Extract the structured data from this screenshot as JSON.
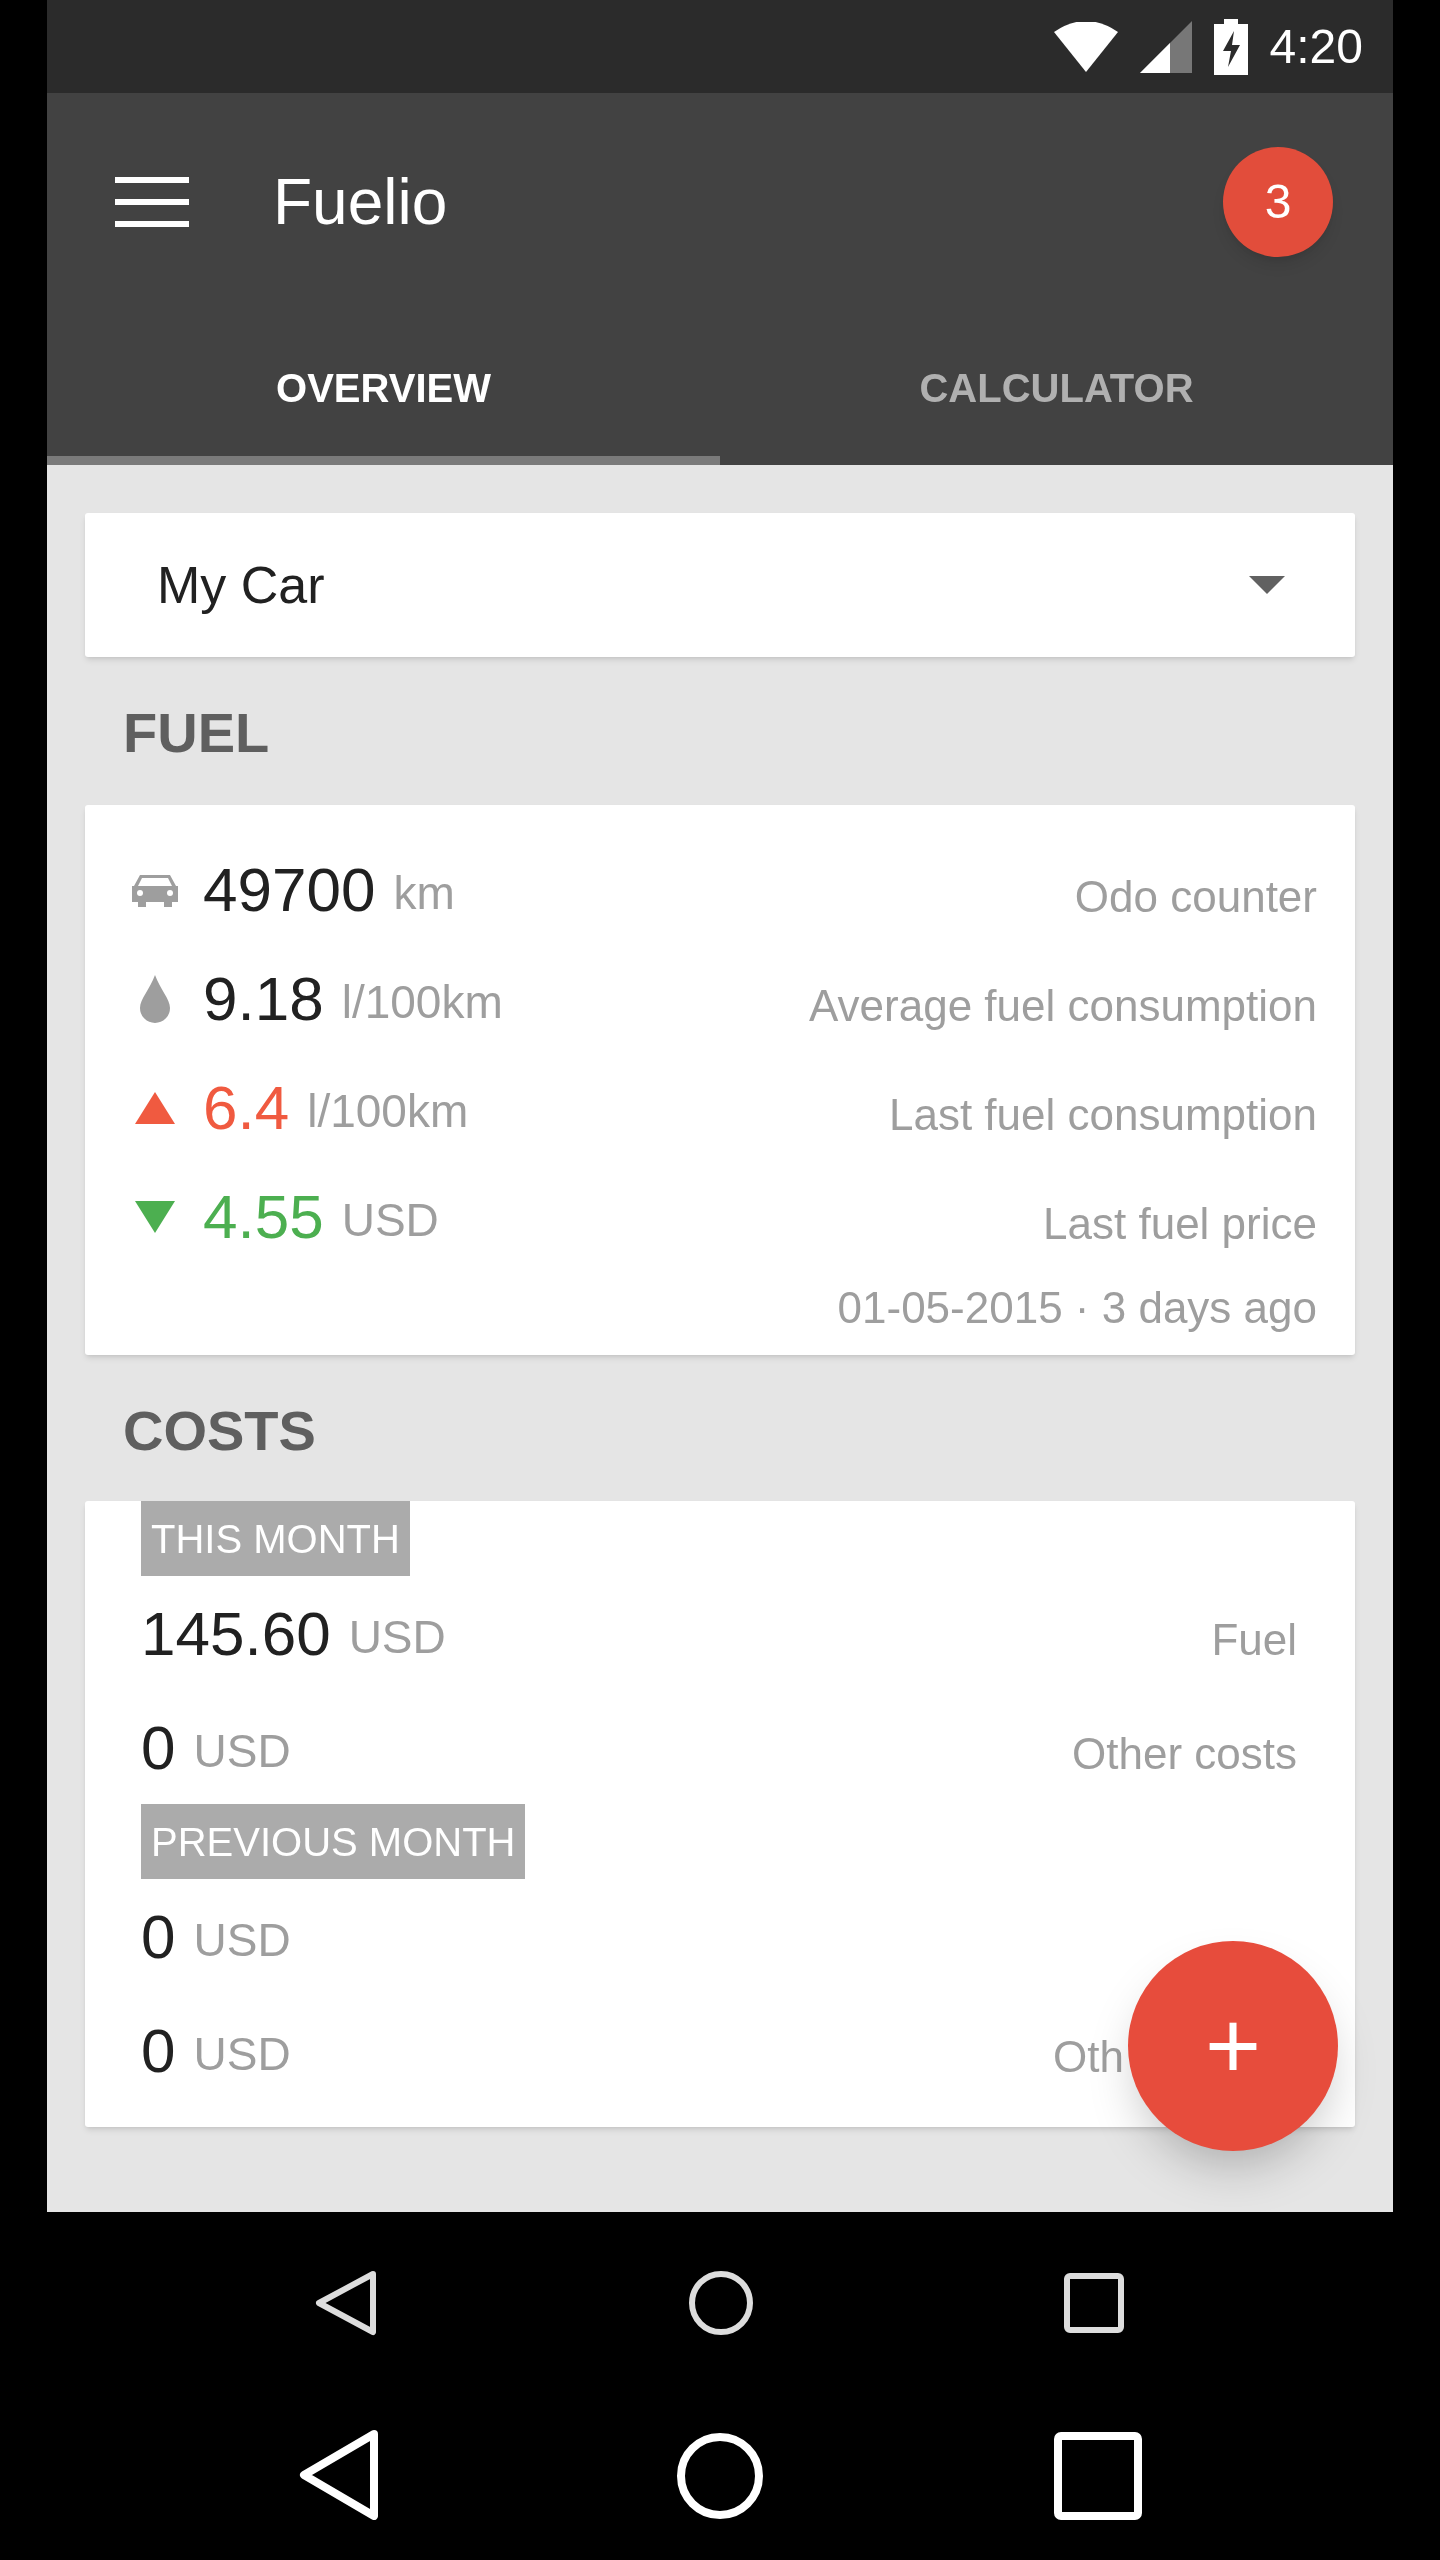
{
  "status_bar": {
    "time": "4:20"
  },
  "app_bar": {
    "title": "Fuelio",
    "badge": "3"
  },
  "tabs": [
    {
      "label": "OVERVIEW",
      "selected": true
    },
    {
      "label": "CALCULATOR",
      "selected": false
    }
  ],
  "vehicle_select": {
    "value": "My Car"
  },
  "fuel": {
    "heading": "FUEL",
    "rows": [
      {
        "kind": "odometer",
        "value": "49700",
        "unit": "km",
        "label": "Odo counter"
      },
      {
        "kind": "average",
        "value": "9.18",
        "unit": "l/100km",
        "label": "Average fuel consumption"
      },
      {
        "kind": "up",
        "value": "6.4",
        "unit": "l/100km",
        "label": "Last fuel consumption"
      },
      {
        "kind": "down",
        "value": "4.55",
        "unit": "USD",
        "label": "Last fuel price"
      }
    ],
    "date": "01-05-2015 · 3 days ago"
  },
  "costs": {
    "heading": "COSTS",
    "groups": [
      {
        "title": "THIS MONTH",
        "rows": [
          {
            "value": "145.60",
            "unit": "USD",
            "label": "Fuel"
          },
          {
            "value": "0",
            "unit": "USD",
            "label": "Other costs"
          }
        ]
      },
      {
        "title": "PREVIOUS MONTH",
        "rows": [
          {
            "value": "0",
            "unit": "USD"
          },
          {
            "value": "0",
            "unit": "USD",
            "label": "Oth",
            "obscured": true
          }
        ]
      }
    ]
  },
  "fab": {
    "label": "+"
  }
}
